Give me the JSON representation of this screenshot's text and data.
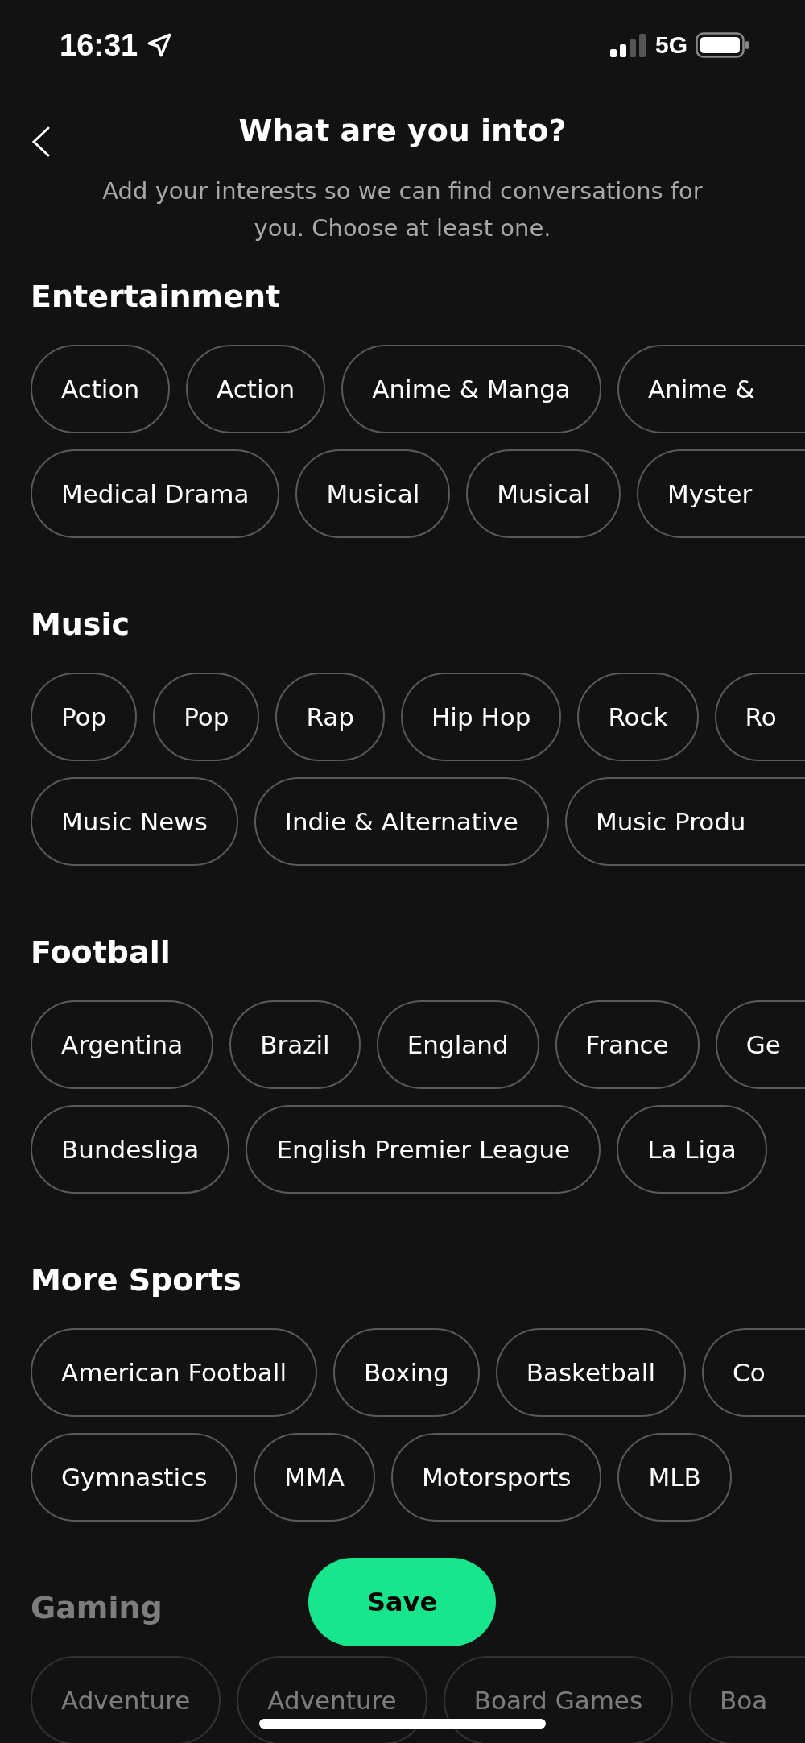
{
  "status_bar": {
    "time": "16:31",
    "network": "5G"
  },
  "header": {
    "title": "What are you into?",
    "subtitle": "Add your interests so we can find conversations for you. Choose at least one."
  },
  "sections": [
    {
      "title": "Entertainment",
      "faded": false,
      "rows": [
        {
          "chips": [
            {
              "label": "Action",
              "selected": false
            },
            {
              "label": "Action",
              "selected": false
            },
            {
              "label": "Anime & Manga",
              "selected": false
            },
            {
              "label": "Anime &",
              "selected": false,
              "cut": true
            }
          ]
        },
        {
          "chips": [
            {
              "label": "Medical Drama",
              "selected": false
            },
            {
              "label": "Musical",
              "selected": false
            },
            {
              "label": "Musical",
              "selected": false
            },
            {
              "label": "Myster",
              "selected": false,
              "cut": true
            }
          ]
        }
      ]
    },
    {
      "title": "Music",
      "faded": false,
      "rows": [
        {
          "chips": [
            {
              "label": "Pop",
              "selected": false
            },
            {
              "label": "Pop",
              "selected": false
            },
            {
              "label": "Rap",
              "selected": false
            },
            {
              "label": "Hip Hop",
              "selected": false
            },
            {
              "label": "Rock",
              "selected": false
            },
            {
              "label": "Ro",
              "selected": false,
              "cut": true
            }
          ]
        },
        {
          "chips": [
            {
              "label": "Music News",
              "selected": false
            },
            {
              "label": "Indie & Alternative",
              "selected": false
            },
            {
              "label": "Music Produ",
              "selected": false,
              "cut": true
            }
          ]
        }
      ]
    },
    {
      "title": "Football",
      "faded": false,
      "rows": [
        {
          "chips": [
            {
              "label": "Argentina",
              "selected": false
            },
            {
              "label": "Brazil",
              "selected": false
            },
            {
              "label": "England",
              "selected": false
            },
            {
              "label": "France",
              "selected": false
            },
            {
              "label": "Ge",
              "selected": false,
              "cut": true
            }
          ]
        },
        {
          "chips": [
            {
              "label": "Bundesliga",
              "selected": false
            },
            {
              "label": "English Premier League",
              "selected": false
            },
            {
              "label": "La Liga",
              "selected": false
            }
          ]
        }
      ]
    },
    {
      "title": "More Sports",
      "faded": false,
      "rows": [
        {
          "chips": [
            {
              "label": "American Football",
              "selected": false
            },
            {
              "label": "Boxing",
              "selected": false
            },
            {
              "label": "Basketball",
              "selected": false
            },
            {
              "label": "Co",
              "selected": false,
              "cut": true
            }
          ]
        },
        {
          "chips": [
            {
              "label": "Gymnastics",
              "selected": false
            },
            {
              "label": "MMA",
              "selected": false
            },
            {
              "label": "Motorsports",
              "selected": false
            },
            {
              "label": "MLB",
              "selected": false
            }
          ]
        }
      ]
    },
    {
      "title": "Gaming",
      "faded": true,
      "rows": [
        {
          "chips": [
            {
              "label": "Adventure",
              "selected": false
            },
            {
              "label": "Adventure",
              "selected": false
            },
            {
              "label": "Board Games",
              "selected": false
            },
            {
              "label": "Boa",
              "selected": false,
              "cut": true
            }
          ]
        }
      ]
    }
  ],
  "save_button": "Save"
}
